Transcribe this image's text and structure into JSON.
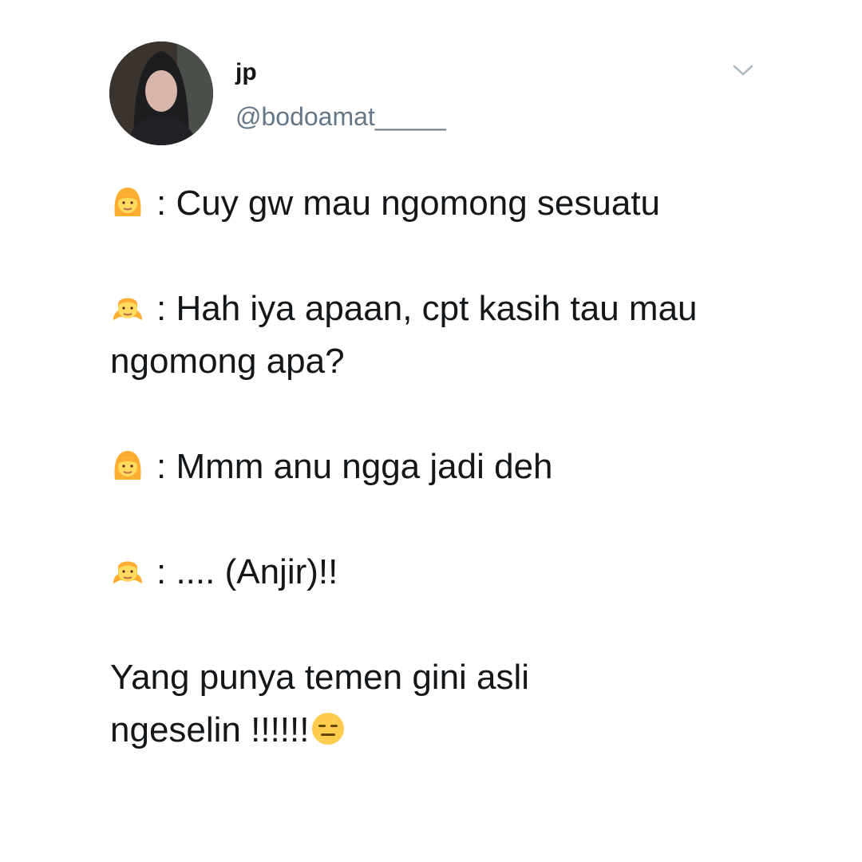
{
  "tweet": {
    "author_name": "jp",
    "author_handle": "@bodoamat_____",
    "menu_icon": "chevron-down-icon",
    "lines": [
      {
        "speaker_icon": "woman-emoji",
        "text": ": Cuy gw mau ngomong sesuatu"
      },
      {
        "speaker_icon": "girl-emoji",
        "text": ": Hah iya apaan, cpt kasih tau mau ngomong apa?"
      },
      {
        "speaker_icon": "woman-emoji",
        "text": ": Mmm anu ngga jadi deh"
      },
      {
        "speaker_icon": "girl-emoji",
        "text": ": .... (Anjir)!!"
      }
    ],
    "closing_text": "Yang punya temen gini asli ngeselin !!!!!!",
    "closing_icon": "expressionless-face-emoji"
  }
}
